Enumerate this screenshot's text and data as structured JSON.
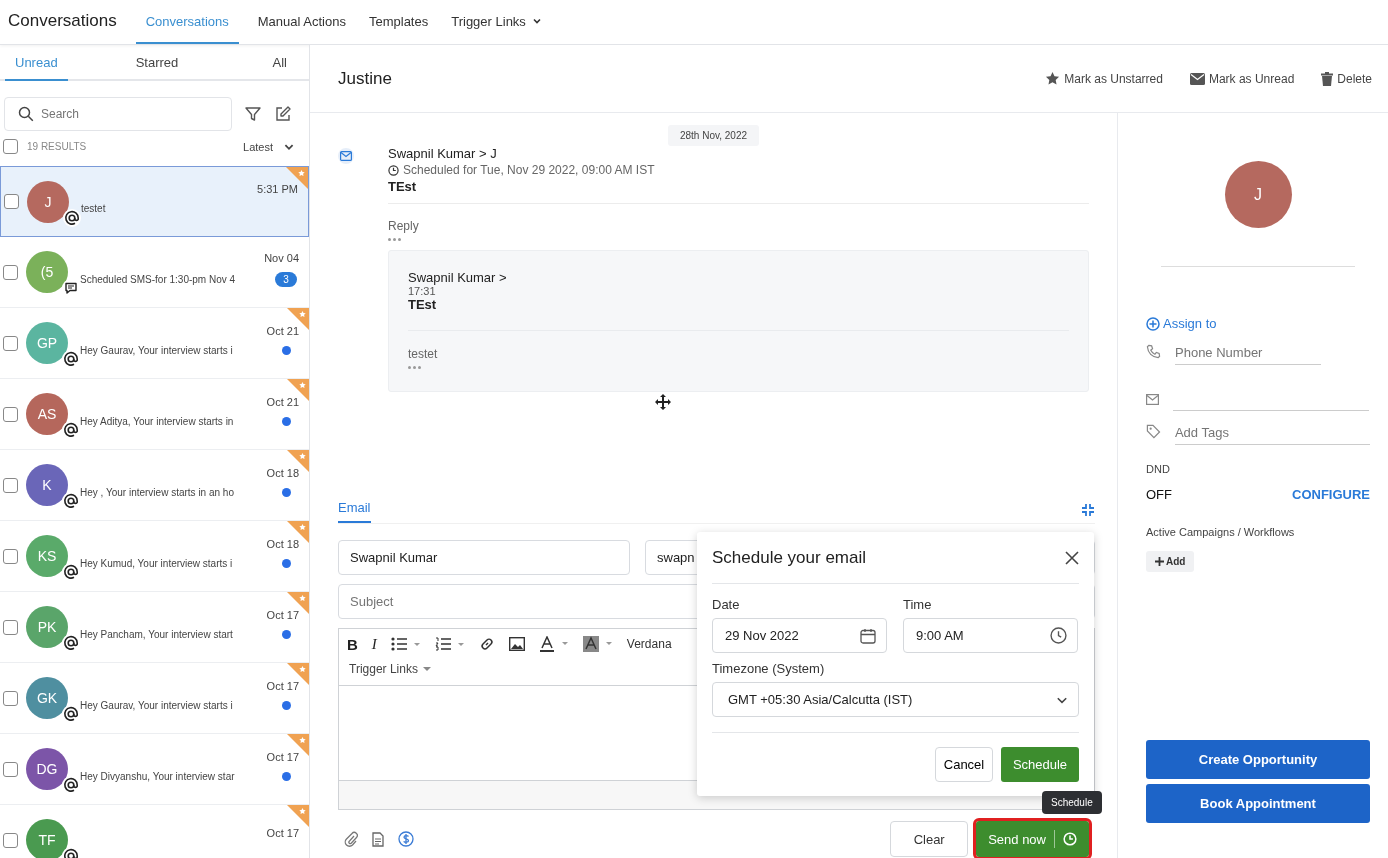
{
  "app_title": "Conversations",
  "nav_tabs": [
    {
      "label": "Conversations",
      "selected": true,
      "dropdown": false
    },
    {
      "label": "Manual Actions",
      "selected": false,
      "dropdown": false
    },
    {
      "label": "Templates",
      "selected": false,
      "dropdown": false
    },
    {
      "label": "Trigger Links",
      "selected": false,
      "dropdown": true
    }
  ],
  "list_tabs": [
    {
      "label": "Unread",
      "selected": true
    },
    {
      "label": "Starred",
      "selected": false
    },
    {
      "label": "All",
      "selected": false
    }
  ],
  "search": {
    "placeholder": "Search"
  },
  "select_all": {
    "checked": false
  },
  "results": "19 RESULTS",
  "sort": "Latest",
  "conversations": [
    {
      "initials": "J",
      "color": "#b5695f",
      "kind": "at",
      "time": "5:31 PM",
      "snippet": "testet",
      "starred": true,
      "unread": false,
      "selected": true
    },
    {
      "initials": "(5",
      "color": "#7bb15a",
      "kind": "sms",
      "time": "Nov 04",
      "snippet": "Scheduled SMS-for 1:30-pm Nov 4",
      "starred": false,
      "unread": false,
      "badge": "3",
      "selected": false
    },
    {
      "initials": "GP",
      "color": "#5bb5a0",
      "kind": "at",
      "time": "Oct 21",
      "snippet": "Hey Gaurav, Your interview starts i",
      "starred": true,
      "unread": true,
      "selected": false
    },
    {
      "initials": "AS",
      "color": "#b5675c",
      "kind": "at",
      "time": "Oct 21",
      "snippet": "Hey Aditya, Your interview starts in",
      "starred": true,
      "unread": true,
      "selected": false
    },
    {
      "initials": "K",
      "color": "#6a66b8",
      "kind": "at",
      "time": "Oct 18",
      "snippet": "Hey , Your interview starts in an ho",
      "starred": true,
      "unread": true,
      "selected": false
    },
    {
      "initials": "KS",
      "color": "#5aaa6a",
      "kind": "at",
      "time": "Oct 18",
      "snippet": "Hey Kumud, Your interview starts i",
      "starred": true,
      "unread": true,
      "selected": false
    },
    {
      "initials": "PK",
      "color": "#5aa56a",
      "kind": "at",
      "time": "Oct 17",
      "snippet": "Hey Pancham, Your interview start",
      "starred": true,
      "unread": true,
      "selected": false
    },
    {
      "initials": "GK",
      "color": "#4f8fa0",
      "kind": "at",
      "time": "Oct 17",
      "snippet": "Hey Gaurav, Your interview starts i",
      "starred": true,
      "unread": true,
      "selected": false
    },
    {
      "initials": "DG",
      "color": "#7c55a8",
      "kind": "at",
      "time": "Oct 17",
      "snippet": "Hey Divyanshu, Your interview star",
      "starred": true,
      "unread": true,
      "selected": false
    },
    {
      "initials": "TF",
      "color": "#4a9a50",
      "kind": "at",
      "time": "Oct 17",
      "starred": true,
      "unread": false,
      "selected": false
    }
  ],
  "conversation": {
    "title": "Justine",
    "actions": [
      {
        "kind": "star",
        "label": "Mark as Unstarred"
      },
      {
        "kind": "mail",
        "label": "Mark as Unread"
      },
      {
        "kind": "trash",
        "label": "Delete"
      }
    ]
  },
  "date_chip": "28th Nov, 2022",
  "message": {
    "header": "Swapnil Kumar > J",
    "scheduled": "Scheduled for Tue, Nov 29 2022, 09:00 AM IST",
    "body": "TEst",
    "reply_label": "Reply",
    "quote": {
      "header": "Swapnil Kumar >",
      "time": "17:31",
      "subject": "TEst",
      "body": "testet"
    }
  },
  "composer": {
    "tabs": [
      {
        "label": "Email",
        "selected": true
      }
    ],
    "from": "Swapnil Kumar",
    "to": "swapn",
    "subject_placeholder": "Subject",
    "bold": "B",
    "italic": "I",
    "font": "Verdana",
    "trigger_links": "Trigger Links",
    "clear": "Clear",
    "send": "Send now"
  },
  "tooltip": "Schedule",
  "schedule_dialog": {
    "title": "Schedule your email",
    "date_label": "Date",
    "date": "29 Nov 2022",
    "time_label": "Time",
    "time": "9:00 AM",
    "tz_label": "Timezone (System)",
    "tz": "GMT +05:30 Asia/Calcutta (IST)",
    "cancel": "Cancel",
    "confirm": "Schedule"
  },
  "contact": {
    "initial": "J",
    "assign": "Assign to",
    "phone_placeholder": "Phone Number",
    "tags_placeholder": "Add Tags",
    "dnd_label": "DND",
    "dnd": "OFF",
    "configure": "CONFIGURE",
    "campaigns_label": "Active Campaigns / Workflows",
    "add": "Add",
    "buttons": [
      "Create Opportunity",
      "Book Appointment"
    ]
  }
}
